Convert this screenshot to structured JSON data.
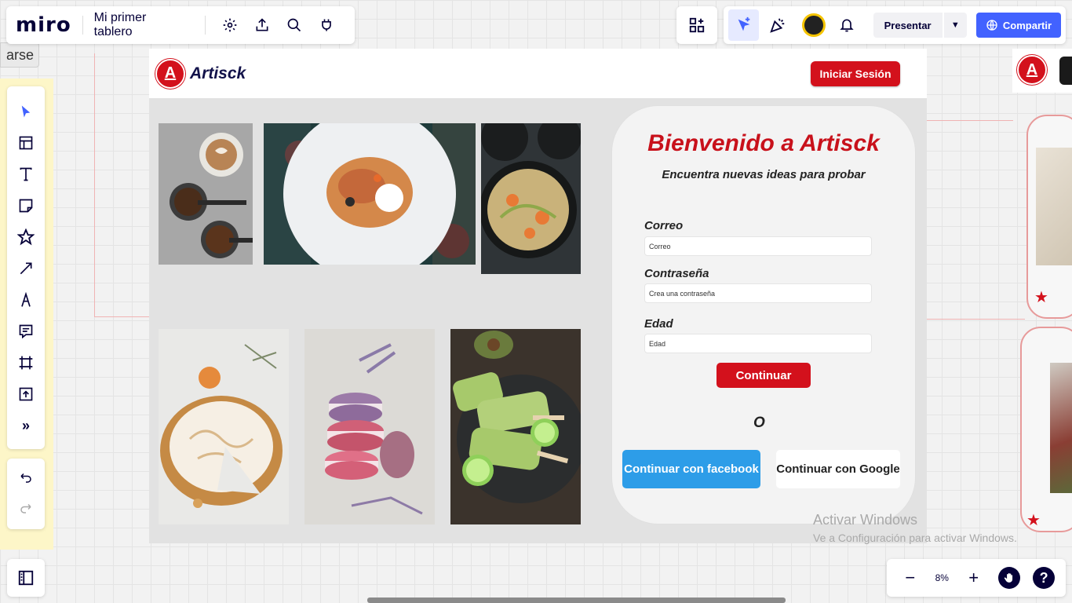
{
  "miro": {
    "logo": "miro",
    "board_name": "Mi primer tablero",
    "present_label": "Presentar",
    "share_label": "Compartir",
    "zoom_level": "8%",
    "side_label": "arse"
  },
  "mockup": {
    "brand": "Artisck",
    "logo_letter": "A",
    "login_label": "Iniciar Sesión",
    "welcome": "Bienvenido a Artisck",
    "subtitle": "Encuentra nuevas ideas para probar",
    "fields": [
      {
        "label": "Correo",
        "placeholder": "Correo"
      },
      {
        "label": "Contraseña",
        "placeholder": "Crea una contraseña"
      },
      {
        "label": "Edad",
        "placeholder": "Edad"
      }
    ],
    "continue_label": "Continuar",
    "or_label": "O",
    "facebook_label": "Continuar con facebook",
    "google_label": "Continuar con Google"
  },
  "watermark": {
    "title": "Activar Windows",
    "subtitle": "Ve a Configuración para activar Windows."
  },
  "icons": {
    "toolbar": [
      "select-icon",
      "templates-icon",
      "text-icon",
      "sticky-note-icon",
      "shapes-icon",
      "connection-line-icon",
      "pen-icon",
      "comment-icon",
      "frame-icon",
      "upload-icon",
      "more-tools-icon"
    ]
  },
  "colors": {
    "brand_red": "#d3111c",
    "miro_blue": "#4262ff",
    "facebook_blue": "#2d9de8",
    "navy": "#050038"
  }
}
